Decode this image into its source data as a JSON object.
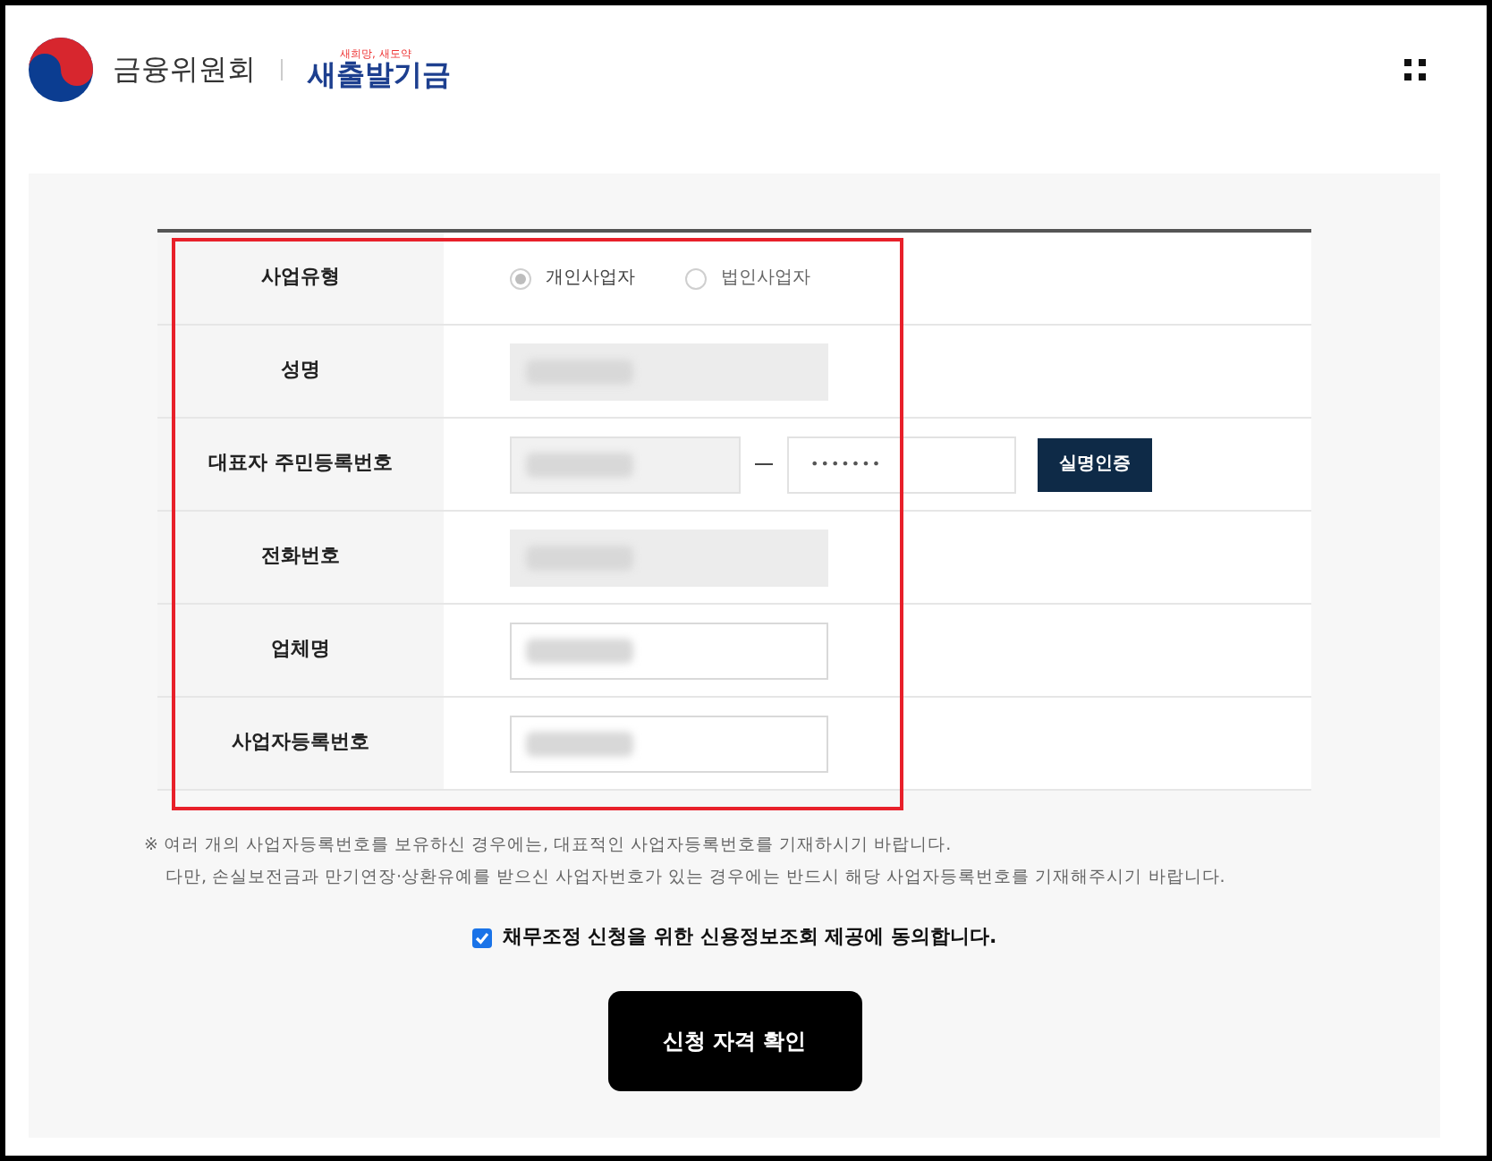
{
  "header": {
    "ministry": "금융위원회",
    "brand": "새출발기금",
    "brand_slogan": "새희망, 새도약"
  },
  "form": {
    "rows": [
      {
        "label": "사업유형",
        "kind": "radio",
        "options": [
          {
            "label": "개인사업자",
            "selected": true
          },
          {
            "label": "법인사업자",
            "selected": false
          }
        ]
      },
      {
        "label": "성명",
        "kind": "locked_text"
      },
      {
        "label": "대표자 주민등록번호",
        "kind": "resident",
        "masked": "•••••••",
        "button": "실명인증"
      },
      {
        "label": "전화번호",
        "kind": "locked_text"
      },
      {
        "label": "업체명",
        "kind": "text"
      },
      {
        "label": "사업자등록번호",
        "kind": "text"
      }
    ]
  },
  "notes": [
    "※ 여러 개의 사업자등록번호를 보유하신 경우에는, 대표적인 사업자등록번호를 기재하시기 바랍니다.",
    "다만, 손실보전금과 만기연장·상환유예를 받으신 사업자번호가 있는 경우에는 반드시 해당 사업자등록번호를 기재해주시기 바랍니다."
  ],
  "consent": {
    "label": "채무조정 신청을 위한 신용정보조회 제공에 동의합니다.",
    "checked": true
  },
  "submit": "신청 자격 확인"
}
